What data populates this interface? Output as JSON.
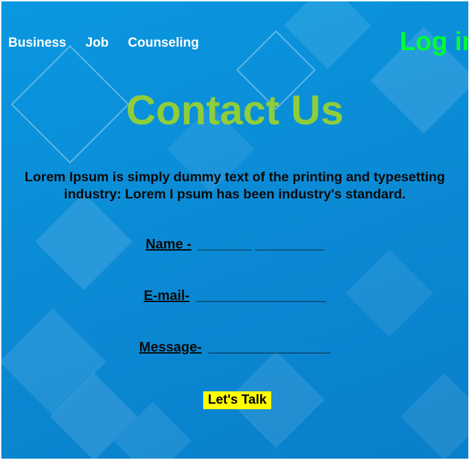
{
  "nav": {
    "items": [
      {
        "label": "Business"
      },
      {
        "label": "Job"
      },
      {
        "label": "Counseling"
      }
    ],
    "login_label": "Log in"
  },
  "main": {
    "title": "Contact Us",
    "intro": "Lorem Ipsum is simply dummy text of the printing and typesetting industry: Lorem I psum has been industry's standard.",
    "fields": {
      "name_label": "Name -",
      "name_line": "_______ _________",
      "email_label": "E-mail-",
      "email_line": "_________________",
      "message_label": "Message-",
      "message_line": "________________"
    },
    "submit_label": "Let's Talk"
  },
  "colors": {
    "background": "#0b8bd6",
    "title": "#8fce3a",
    "login": "#00ff33",
    "button_bg": "#ffff00",
    "nav_text": "#ffffff",
    "body_text": "#0a0a0a"
  }
}
